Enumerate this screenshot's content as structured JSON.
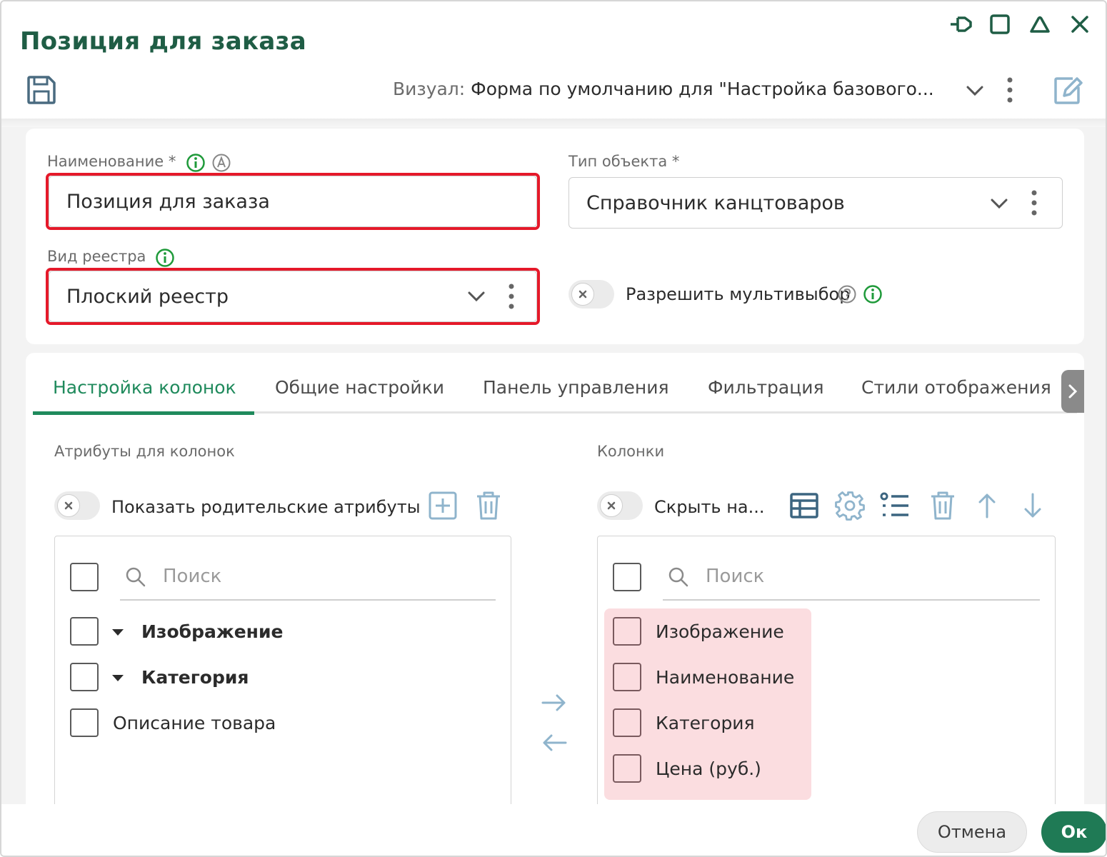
{
  "window": {
    "title": "Позиция для заказа",
    "controls": [
      "pin-icon",
      "maximize-icon",
      "collapse-icon",
      "close-icon"
    ]
  },
  "toolbar": {
    "visual_label": "Визуал:",
    "visual_value": "Форма по умолчанию для \"Настройка базового..."
  },
  "form": {
    "name_label": "Наименование *",
    "name_value": "Позиция для заказа",
    "object_type_label": "Тип объекта *",
    "object_type_value": "Справочник канцтоваров",
    "registry_type_label": "Вид реестра",
    "registry_type_value": "Плоский реестр",
    "multiselect_label": "Разрешить мультивыбор",
    "multiselect_enabled": false
  },
  "tabs": [
    {
      "label": "Настройка колонок",
      "active": true
    },
    {
      "label": "Общие настройки",
      "active": false
    },
    {
      "label": "Панель управления",
      "active": false
    },
    {
      "label": "Фильтрация",
      "active": false
    },
    {
      "label": "Стили отображения",
      "active": false
    }
  ],
  "attributes": {
    "title": "Атрибуты для колонок",
    "toggle_label": "Показать родительские атрибуты",
    "search_placeholder": "Поиск",
    "items": [
      {
        "label": "Изображение",
        "expandable": true
      },
      {
        "label": "Категория",
        "expandable": true
      },
      {
        "label": "Описание товара",
        "expandable": false
      }
    ]
  },
  "columns": {
    "title": "Колонки",
    "toggle_label": "Скрыть на...",
    "search_placeholder": "Поиск",
    "items": [
      "Изображение",
      "Наименование",
      "Категория",
      "Цена (руб.)"
    ]
  },
  "footer": {
    "cancel_label": "Отмена",
    "ok_label": "Ок"
  },
  "colors": {
    "accent": "#1f8a5c",
    "title": "#1f5d45",
    "highlight": "#e5192a",
    "selection": "#fbdde0"
  }
}
